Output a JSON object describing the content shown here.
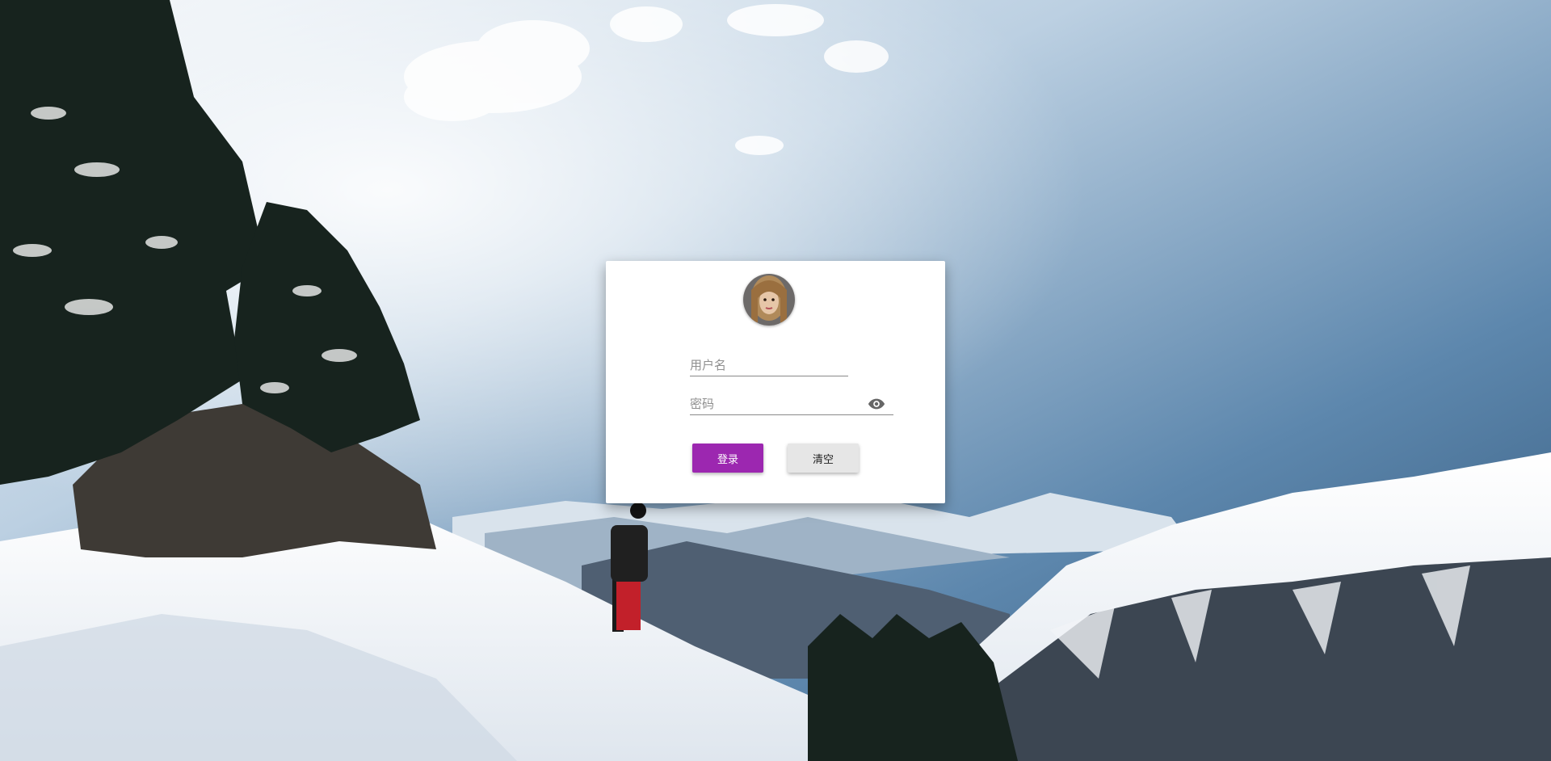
{
  "login": {
    "avatar_alt": "avatar",
    "username_placeholder": "用户名",
    "password_placeholder": "密码",
    "login_label": "登录",
    "clear_label": "清空",
    "eye_icon": "eye-icon"
  },
  "colors": {
    "primary": "#9c27b0",
    "secondary": "#e6e6e6",
    "card": "#ffffff"
  }
}
